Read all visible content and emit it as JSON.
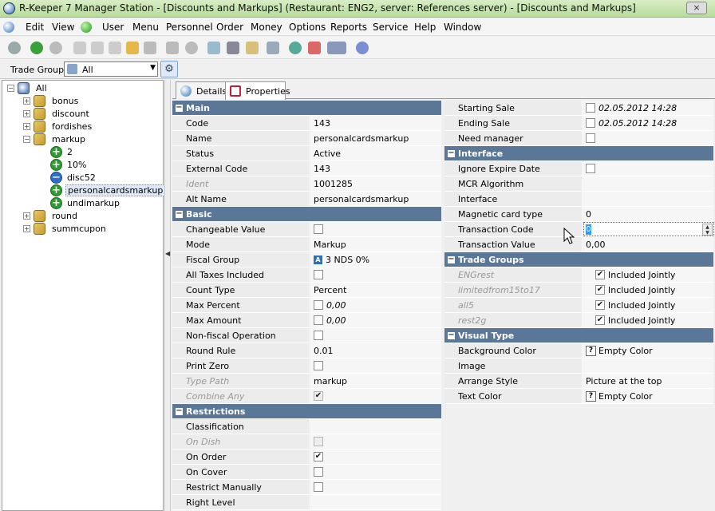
{
  "window": {
    "title": "R-Keeper 7 Manager Station - [Discounts and Markups] (Restaurant: ENG2, server: References server) - [Discounts and Markups]",
    "close": "×"
  },
  "menu": [
    "Edit",
    "View",
    "User",
    "Menu",
    "Personnel",
    "Order",
    "Money",
    "Options",
    "Reports",
    "Service",
    "Help",
    "Window"
  ],
  "tradegroup": {
    "label": "Trade Group:",
    "value": "All"
  },
  "tree": {
    "root": "All",
    "folders": [
      "bonus",
      "discount",
      "fordishes",
      "markup"
    ],
    "markup_children": [
      "2",
      "10%",
      "disc52",
      "personalcardsmarkup",
      "undimarkup"
    ],
    "folders_after": [
      "round",
      "summcupon"
    ]
  },
  "tabs": [
    "Details",
    "Properties"
  ],
  "left": {
    "main": {
      "title": "Main",
      "rows": [
        {
          "name": "Code",
          "value": "143"
        },
        {
          "name": "Name",
          "value": "personalcardsmarkup"
        },
        {
          "name": "Status",
          "value": "Active"
        },
        {
          "name": "External Code",
          "value": "143"
        },
        {
          "name": "Ident",
          "value": "1001285"
        },
        {
          "name": "Alt Name",
          "value": "personalcardsmarkup"
        }
      ]
    },
    "basic": {
      "title": "Basic",
      "rows": [
        {
          "name": "Changeable Value"
        },
        {
          "name": "Mode",
          "value": "Markup"
        },
        {
          "name": "Fiscal Group",
          "value": "3 NDS 0%",
          "badge": "A"
        },
        {
          "name": "All Taxes Included"
        },
        {
          "name": "Count Type",
          "value": "Percent"
        },
        {
          "name": "Max Percent",
          "value": "0,00"
        },
        {
          "name": "Max Amount",
          "value": "0,00"
        },
        {
          "name": "Non-fiscal Operation"
        },
        {
          "name": "Round Rule",
          "value": "0.01"
        },
        {
          "name": "Print Zero"
        },
        {
          "name": "Type Path",
          "value": "markup"
        },
        {
          "name": "Combine Any"
        }
      ]
    },
    "restrictions": {
      "title": "Restrictions",
      "rows": [
        {
          "name": "Classification"
        },
        {
          "name": "On Dish"
        },
        {
          "name": "On Order"
        },
        {
          "name": "On Cover"
        },
        {
          "name": "Restrict Manually"
        },
        {
          "name": "Right Level"
        }
      ]
    }
  },
  "right": {
    "top": {
      "rows": [
        {
          "name": "Starting Sale",
          "value": "02.05.2012 14:28"
        },
        {
          "name": "Ending Sale",
          "value": "02.05.2012 14:28"
        },
        {
          "name": "Need manager"
        }
      ]
    },
    "interface": {
      "title": "Interface",
      "rows": [
        {
          "name": "Ignore Expire Date"
        },
        {
          "name": "MCR Algorithm"
        },
        {
          "name": "Interface"
        },
        {
          "name": "Magnetic card type",
          "value": "0"
        },
        {
          "name": "Transaction Code",
          "value": "0"
        },
        {
          "name": "Transaction Value",
          "value": "0,00"
        }
      ]
    },
    "trade": {
      "title": "Trade Groups",
      "rows": [
        {
          "name": "ENGrest",
          "value": "Included Jointly"
        },
        {
          "name": "limitedfrom15to17",
          "value": "Included Jointly"
        },
        {
          "name": "all5",
          "value": "Included Jointly"
        },
        {
          "name": "rest2g",
          "value": "Included Jointly"
        }
      ]
    },
    "visual": {
      "title": "Visual Type",
      "rows": [
        {
          "name": "Background Color",
          "value": "Empty Color",
          "badge": "?"
        },
        {
          "name": "Image"
        },
        {
          "name": "Arrange Style",
          "value": "Picture at the top"
        },
        {
          "name": "Text Color",
          "value": "Empty Color",
          "badge": "?"
        }
      ]
    }
  }
}
